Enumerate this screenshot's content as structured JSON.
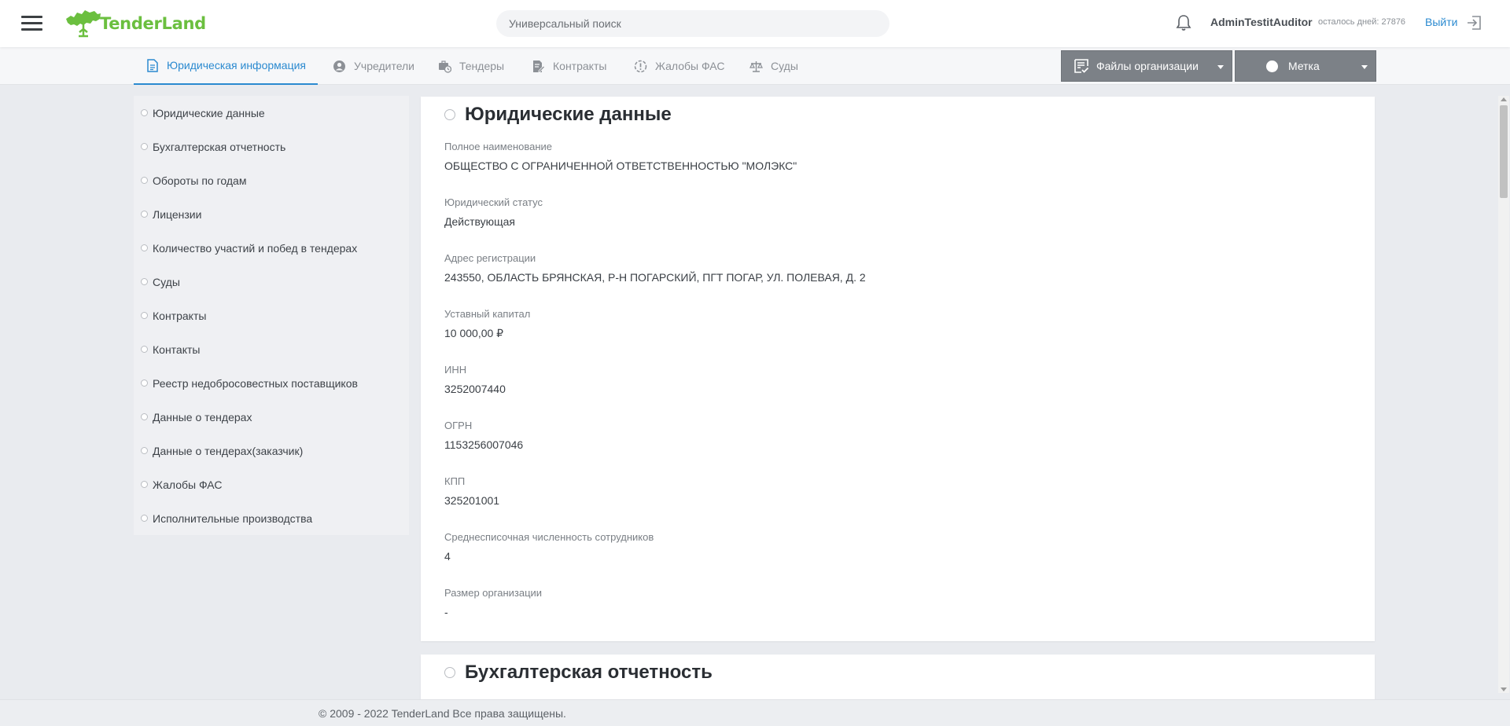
{
  "header": {
    "logo_text": "TenderLand",
    "search_placeholder": "Универсальный поиск",
    "user_name": "AdminTestitAuditor",
    "days_left": "осталось дней: 27876",
    "logout_label": "Выйти"
  },
  "tabs": [
    {
      "label": "Юридическая информация",
      "icon": "document-icon",
      "active": true
    },
    {
      "label": "Учредители",
      "icon": "user-circle-icon",
      "active": false
    },
    {
      "label": "Тендеры",
      "icon": "briefcase-clock-icon",
      "active": false
    },
    {
      "label": "Контракты",
      "icon": "contract-icon",
      "active": false
    },
    {
      "label": "Жалобы ФАС",
      "icon": "alert-circle-icon",
      "active": false
    },
    {
      "label": "Суды",
      "icon": "scales-icon",
      "active": false
    }
  ],
  "actions": {
    "files_label": "Файлы организации",
    "mark_label": "Метка"
  },
  "sidebar": {
    "items": [
      {
        "label": "Юридические данные"
      },
      {
        "label": "Бухгалтерская отчетность"
      },
      {
        "label": "Обороты по годам"
      },
      {
        "label": "Лицензии"
      },
      {
        "label": "Количество участий и побед в тендерах"
      },
      {
        "label": "Суды"
      },
      {
        "label": "Контракты"
      },
      {
        "label": "Контакты"
      },
      {
        "label": "Реестр недобросовестных поставщиков"
      },
      {
        "label": "Данные о тендерах"
      },
      {
        "label": "Данные о тендерах(заказчик)"
      },
      {
        "label": "Жалобы ФАС"
      },
      {
        "label": "Исполнительные производства"
      }
    ]
  },
  "legal": {
    "title": "Юридические данные",
    "fields": [
      {
        "label": "Полное наименование",
        "value": "ОБЩЕСТВО С ОГРАНИЧЕННОЙ ОТВЕТСТВЕННОСТЬЮ \"МОЛЭКС\""
      },
      {
        "label": "Юридический статус",
        "value": "Действующая"
      },
      {
        "label": "Адрес регистрации",
        "value": "243550, ОБЛАСТЬ БРЯНСКАЯ, Р-Н ПОГАРСКИЙ, ПГТ ПОГАР, УЛ. ПОЛЕВАЯ, Д. 2"
      },
      {
        "label": "Уставный капитал",
        "value": "10 000,00 ₽"
      },
      {
        "label": "ИНН",
        "value": "3252007440"
      },
      {
        "label": "ОГРН",
        "value": "1153256007046"
      },
      {
        "label": "КПП",
        "value": "325201001"
      },
      {
        "label": "Среднесписочная численность сотрудников",
        "value": "4"
      },
      {
        "label": "Размер организации",
        "value": "-"
      }
    ]
  },
  "accounting": {
    "title": "Бухгалтерская отчетность"
  },
  "footer": {
    "copyright": "© 2009 - 2022 TenderLand Все права защищены."
  },
  "colors": {
    "accent": "#2b8ad0",
    "brand": "#6bbf3f",
    "button_gray": "#7c8187"
  }
}
